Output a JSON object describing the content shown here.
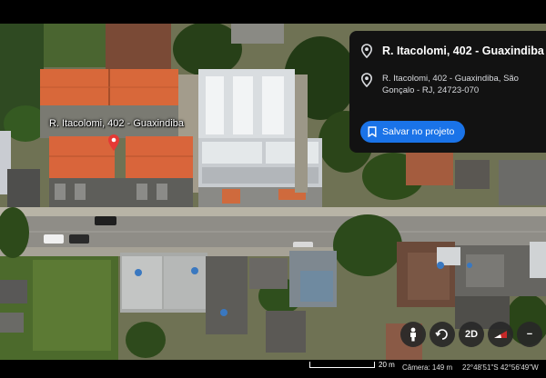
{
  "place": {
    "map_label": "R. Itacolomi, 402 - Guaxindiba",
    "panel_title": "R. Itacolomi, 402 - Guaxindiba",
    "full_address": "R. Itacolomi, 402 - Guaxindiba, São Gonçalo - RJ, 24723-070"
  },
  "actions": {
    "save_label": "Salvar no projeto"
  },
  "controls": {
    "pegman_icon": "pegman-icon",
    "rotate_icon": "rotate-icon",
    "view_mode_label": "2D",
    "layers_icon": "layers-icon",
    "zoom_out_label": "−"
  },
  "status": {
    "scale_label": "20 m",
    "camera_label": "Câmera: 149 m",
    "coordinates": "22°48'51\"S 42°56'49\"W"
  },
  "colors": {
    "accent": "#1a73e8",
    "panel_bg": "#121212",
    "pin": "#e53935"
  }
}
